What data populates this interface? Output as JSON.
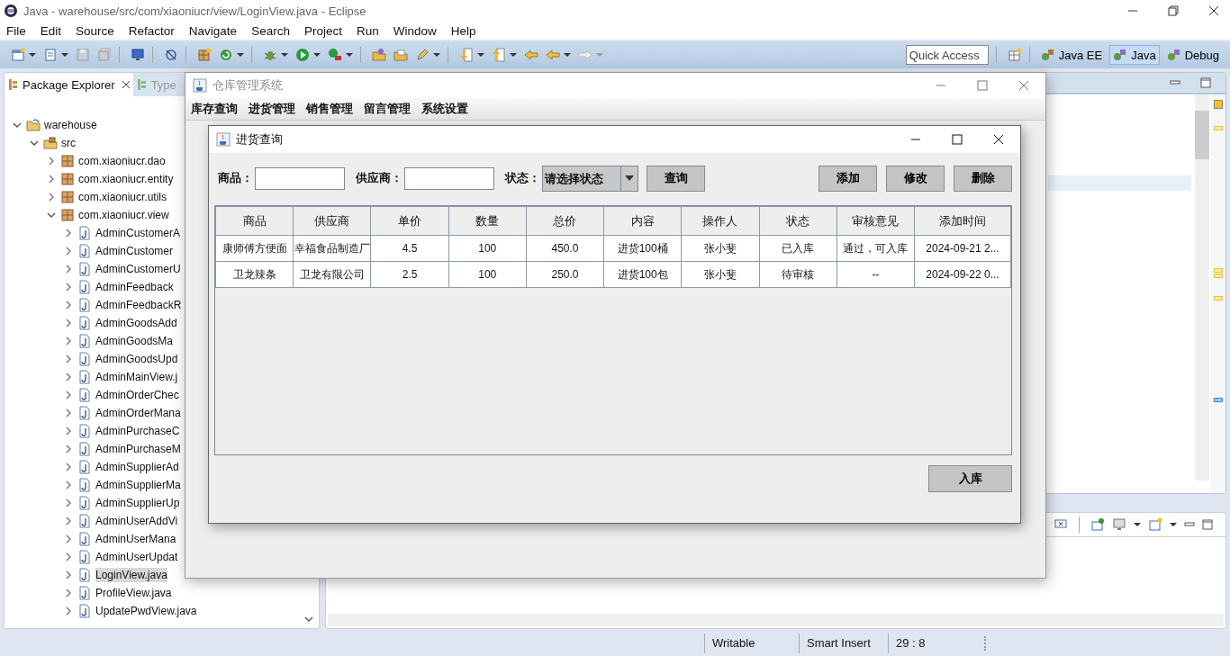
{
  "window": {
    "title": "Java - warehouse/src/com/xiaoniucr/view/LoginView.java - Eclipse"
  },
  "menu": [
    "File",
    "Edit",
    "Source",
    "Refactor",
    "Navigate",
    "Search",
    "Project",
    "Run",
    "Window",
    "Help"
  ],
  "quick_access": {
    "placeholder": "Quick Access"
  },
  "perspectives": [
    {
      "label": "Java EE",
      "selected": false
    },
    {
      "label": "Java",
      "selected": true
    },
    {
      "label": "Debug",
      "selected": false
    }
  ],
  "views": [
    {
      "label": "Package Explorer",
      "selected": true
    },
    {
      "label": "Type",
      "selected": false
    }
  ],
  "tree": [
    {
      "label": "warehouse",
      "kind": "project",
      "expanded": true,
      "selected": false,
      "children": [
        {
          "label": "src",
          "kind": "folder",
          "expanded": true,
          "selected": false,
          "children": [
            {
              "label": "com.xiaoniucr.dao",
              "kind": "package",
              "expanded": false,
              "selected": false
            },
            {
              "label": "com.xiaoniucr.entity",
              "kind": "package",
              "expanded": false,
              "selected": false
            },
            {
              "label": "com.xiaoniucr.utils",
              "kind": "package",
              "expanded": false,
              "selected": false
            },
            {
              "label": "com.xiaoniucr.view",
              "kind": "package",
              "expanded": true,
              "selected": false,
              "children": [
                {
                  "label": "AdminCustomerA",
                  "kind": "file",
                  "expanded": false,
                  "selected": false
                },
                {
                  "label": "AdminCustomer",
                  "kind": "file",
                  "expanded": false,
                  "selected": false
                },
                {
                  "label": "AdminCustomerU",
                  "kind": "file",
                  "expanded": false,
                  "selected": false
                },
                {
                  "label": "AdminFeedback",
                  "kind": "file",
                  "expanded": false,
                  "selected": false
                },
                {
                  "label": "AdminFeedbackR",
                  "kind": "file",
                  "expanded": false,
                  "selected": false
                },
                {
                  "label": "AdminGoodsAdd",
                  "kind": "file",
                  "expanded": false,
                  "selected": false
                },
                {
                  "label": "AdminGoodsMa",
                  "kind": "file",
                  "expanded": false,
                  "selected": false
                },
                {
                  "label": "AdminGoodsUpd",
                  "kind": "file",
                  "expanded": false,
                  "selected": false
                },
                {
                  "label": "AdminMainView.j",
                  "kind": "file",
                  "expanded": false,
                  "selected": false
                },
                {
                  "label": "AdminOrderChec",
                  "kind": "file",
                  "expanded": false,
                  "selected": false
                },
                {
                  "label": "AdminOrderMana",
                  "kind": "file",
                  "expanded": false,
                  "selected": false
                },
                {
                  "label": "AdminPurchaseC",
                  "kind": "file",
                  "expanded": false,
                  "selected": false
                },
                {
                  "label": "AdminPurchaseM",
                  "kind": "file",
                  "expanded": false,
                  "selected": false
                },
                {
                  "label": "AdminSupplierAd",
                  "kind": "file",
                  "expanded": false,
                  "selected": false
                },
                {
                  "label": "AdminSupplierMa",
                  "kind": "file",
                  "expanded": false,
                  "selected": false
                },
                {
                  "label": "AdminSupplierUp",
                  "kind": "file",
                  "expanded": false,
                  "selected": false
                },
                {
                  "label": "AdminUserAddVi",
                  "kind": "file",
                  "expanded": false,
                  "selected": false
                },
                {
                  "label": "AdminUserMana",
                  "kind": "file",
                  "expanded": false,
                  "selected": false
                },
                {
                  "label": "AdminUserUpdat",
                  "kind": "file",
                  "expanded": false,
                  "selected": false
                },
                {
                  "label": "LoginView.java",
                  "kind": "file",
                  "expanded": false,
                  "selected": true
                },
                {
                  "label": "ProfileView.java",
                  "kind": "file",
                  "expanded": false,
                  "selected": false
                },
                {
                  "label": "UpdatePwdView.java",
                  "kind": "file",
                  "expanded": false,
                  "selected": false
                }
              ]
            }
          ]
        }
      ]
    }
  ],
  "status_bar": [
    "Writable",
    "Smart Insert",
    "29 : 8"
  ],
  "app_window": {
    "title": "仓库管理系统",
    "menu": [
      "库存查询",
      "进货管理",
      "销售管理",
      "留言管理",
      "系统设置"
    ]
  },
  "dialog": {
    "title": "进货查询",
    "filters": [
      {
        "kind": "field",
        "label": "商品："
      },
      {
        "kind": "field",
        "label": "供应商："
      },
      {
        "kind": "combo",
        "label": "状态：",
        "value": "请选择状态"
      }
    ],
    "search_button": "查询",
    "actions": [
      "添加",
      "修改",
      "删除"
    ],
    "table": {
      "columns": [
        "商品",
        "供应商",
        "单价",
        "数量",
        "总价",
        "内容",
        "操作人",
        "状态",
        "审核意见",
        "添加时间"
      ],
      "rows": [
        [
          "康师傅方便面",
          "幸福食品制造厂",
          "4.5",
          "100",
          "450.0",
          "进货100桶",
          "张小斐",
          "已入库",
          "通过，可入库",
          "2024-09-21 2..."
        ],
        [
          "卫龙辣条",
          "卫龙有限公司",
          "2.5",
          "100",
          "250.0",
          "进货100包",
          "张小斐",
          "待审核",
          "--",
          "2024-09-22 0..."
        ]
      ]
    },
    "footer_button": "入库"
  }
}
